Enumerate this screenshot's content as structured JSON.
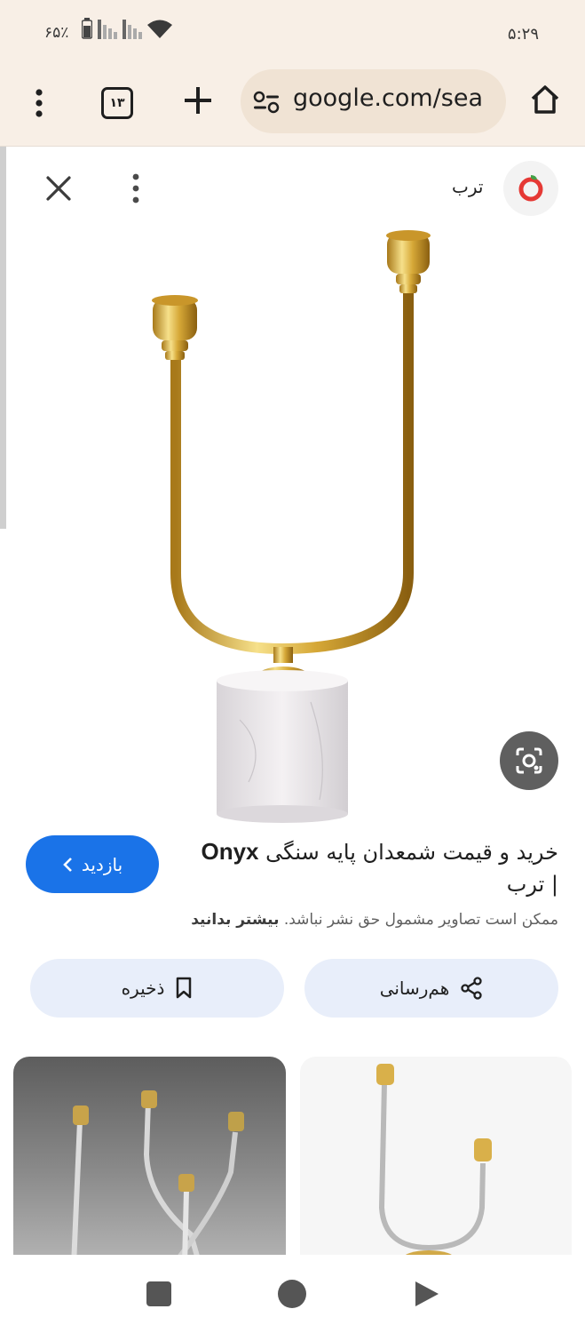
{
  "status_bar": {
    "battery_percent": "۶۵٪",
    "time": "۵:۲۹"
  },
  "toolbar": {
    "tab_count": "۱۳",
    "url": "google.com/sea"
  },
  "source": {
    "name": "ترب"
  },
  "result": {
    "title_brand": "Onyx",
    "title_main": "خرید و قیمت شمعدان پایه سنگی",
    "title_suffix": "| ترب",
    "visit_label": "بازدید",
    "copyright_notice": "ممکن است تصاویر مشمول حق نشر نباشد.",
    "learn_more": "بیشتر بدانید"
  },
  "actions": {
    "share_label": "هم‌رسانی",
    "save_label": "ذخیره"
  },
  "colors": {
    "toolbar_bg": "#f8efe6",
    "accent": "#1a73e8",
    "action_bg": "#e8eefa",
    "brand_red": "#e53935"
  }
}
